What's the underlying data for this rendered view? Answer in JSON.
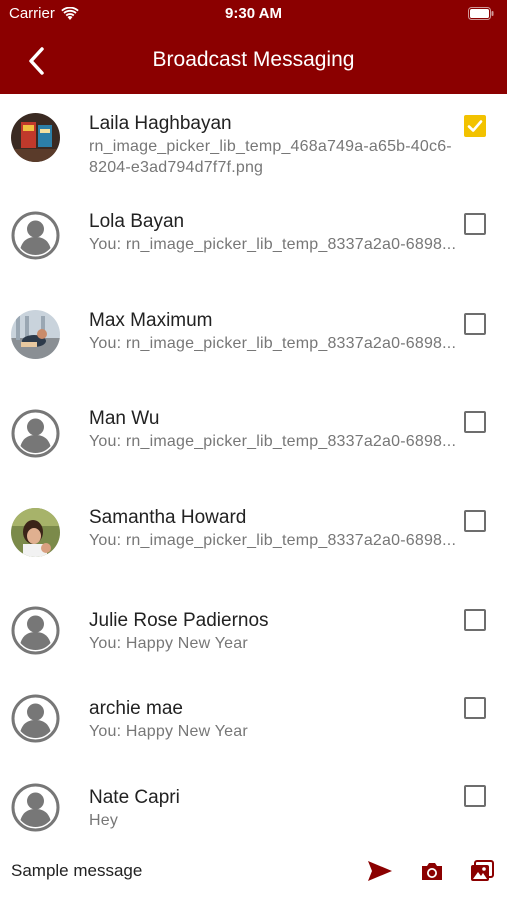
{
  "status_bar": {
    "carrier": "Carrier",
    "time": "9:30 AM"
  },
  "header": {
    "title": "Broadcast Messaging",
    "back_icon": "chevron-left-icon"
  },
  "colors": {
    "brand": "#8b0000",
    "checked": "#f2c200"
  },
  "contacts": [
    {
      "name": "Laila Haghbayan",
      "preview": "rn_image_picker_lib_temp_468a749a-a65b-40c6-8204-e3ad794d7f7f.png",
      "avatar": "photo-avatar",
      "checked": true
    },
    {
      "name": "Lola Bayan",
      "preview": "You: rn_image_picker_lib_temp_8337a2a0-6898...",
      "avatar": "default-user-avatar",
      "checked": false
    },
    {
      "name": "Max Maximum",
      "preview": "You: rn_image_picker_lib_temp_8337a2a0-6898...",
      "avatar": "photo-avatar",
      "checked": false
    },
    {
      "name": "Man Wu",
      "preview": "You: rn_image_picker_lib_temp_8337a2a0-6898...",
      "avatar": "default-user-avatar",
      "checked": false
    },
    {
      "name": "Samantha Howard",
      "preview": "You: rn_image_picker_lib_temp_8337a2a0-6898...",
      "avatar": "photo-avatar",
      "checked": false
    },
    {
      "name": "Julie Rose Padiernos",
      "preview": "You: Happy  New Year",
      "avatar": "default-user-avatar",
      "checked": false
    },
    {
      "name": "archie mae",
      "preview": "You: Happy  New Year",
      "avatar": "default-user-avatar",
      "checked": false
    },
    {
      "name": "Nate Capri",
      "preview": "Hey",
      "avatar": "default-user-avatar",
      "checked": false
    }
  ],
  "composer": {
    "value": "Sample message",
    "icons": [
      "send-icon",
      "camera-icon",
      "image-gallery-icon"
    ]
  }
}
